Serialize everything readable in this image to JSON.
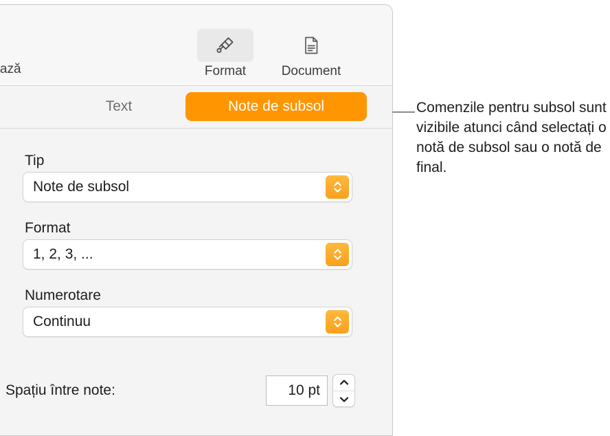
{
  "panel": {
    "toolbar": {
      "left_partial_label": "rează",
      "buttons": [
        {
          "label": "Format",
          "icon": "paintbrush-icon",
          "selected": true
        },
        {
          "label": "Document",
          "icon": "document-page-icon",
          "selected": false
        }
      ]
    },
    "segmented_control": {
      "options": [
        {
          "label": "Text",
          "selected": false
        },
        {
          "label": "Note de subsol",
          "selected": true
        }
      ],
      "selected_color": "#ff9500"
    },
    "fields": [
      {
        "label": "Tip",
        "value": "Note de subsol"
      },
      {
        "label": "Format",
        "value": "1, 2, 3, ..."
      },
      {
        "label": "Numerotare",
        "value": "Continuu"
      }
    ],
    "spacing": {
      "label": "Spațiu între note:",
      "value": "10 pt"
    }
  },
  "callout": {
    "text": "Comenzile pentru subsol sunt vizibile atunci când selectați o notă de subsol sau o notă de final."
  }
}
